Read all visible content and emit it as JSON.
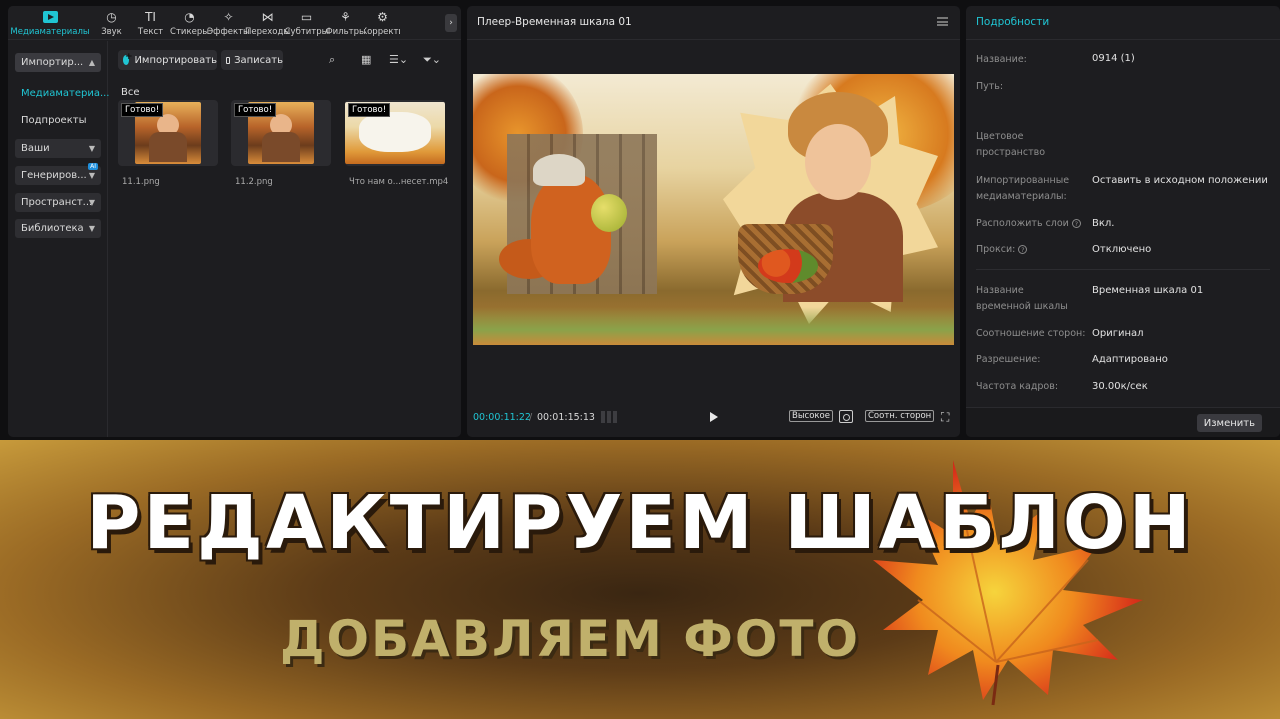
{
  "toolbar": {
    "items": [
      {
        "label": "Медиаматериалы",
        "icon": "media-icon",
        "glyph": ""
      },
      {
        "label": "Звук",
        "icon": "audio-icon",
        "glyph": "◷"
      },
      {
        "label": "Текст",
        "icon": "text-icon",
        "glyph": "TI"
      },
      {
        "label": "Стикеры",
        "icon": "sticker-icon",
        "glyph": "◔"
      },
      {
        "label": "Эффекты",
        "icon": "effects-icon",
        "glyph": "✧"
      },
      {
        "label": "Переходы",
        "icon": "transitions-icon",
        "glyph": "⋈"
      },
      {
        "label": "Субтитры",
        "icon": "subtitles-icon",
        "glyph": "▭"
      },
      {
        "label": "Фильтры",
        "icon": "filters-icon",
        "glyph": "⚘"
      },
      {
        "label": "Корректи",
        "icon": "adjust-icon",
        "glyph": "⚙"
      }
    ],
    "more_glyph": "›"
  },
  "media_sidebar": {
    "import_label": "Импортир...",
    "media_label": "Медиаматериа...",
    "subprojects_label": "Подпроекты",
    "yours_label": "Ваши",
    "generate_label": "Генериров...",
    "space_label": "Пространст...",
    "library_label": "Библиотека",
    "ai_badge": "AI"
  },
  "media_main": {
    "import_button": "Импортировать",
    "record_button": "Записать",
    "search_glyph": "⌕",
    "view_glyph": "▦",
    "sort_glyph": "☰⌄",
    "filter_glyph": "⏷⌄",
    "all_label": "Все",
    "clips": [
      {
        "name": "11.1.png",
        "status": "Готово!"
      },
      {
        "name": "11.2.png",
        "status": "Готово!"
      },
      {
        "name": "Что нам о...несет.mp4",
        "status": "Готово!"
      }
    ]
  },
  "player": {
    "title": "Плеер-Временная шкала 01",
    "current_time": "00:00:11:22",
    "separator": "/",
    "total_time": "00:01:15:13",
    "quality_label": "Высокое",
    "ratio_label": "Соотн. сторон",
    "fullscreen_glyph": "⛶"
  },
  "details": {
    "title": "Подробности",
    "rows": [
      {
        "label": "Название:",
        "value": "0914 (1)"
      },
      {
        "label": "Путь:",
        "value": ""
      },
      {
        "label": "Цветовое пространство",
        "value": ""
      },
      {
        "label": "Импортированные медиаматериалы:",
        "value": "Оставить в исходном положении"
      },
      {
        "label": "Расположить слои",
        "value": "Вкл."
      },
      {
        "label": "Прокси:",
        "value": "Отключено"
      },
      {
        "label": "Название временной шкалы",
        "value": "Временная шкала 01"
      },
      {
        "label": "Соотношение сторон:",
        "value": "Оригинал"
      },
      {
        "label": "Разрешение:",
        "value": "Адаптировано"
      },
      {
        "label": "Частота кадров:",
        "value": "30.00к/сек"
      }
    ],
    "change_button": "Изменить",
    "help_glyph": "?"
  },
  "banner": {
    "headline": "РЕДАКТИРУЕМ ШАБЛОН",
    "subline": "ДОБАВЛЯЕМ ФОТО"
  },
  "colors": {
    "accent": "#20c5d3",
    "banner_dark": "#3a2612",
    "banner_light": "#c79a3b",
    "subline": "#c0b06b"
  }
}
